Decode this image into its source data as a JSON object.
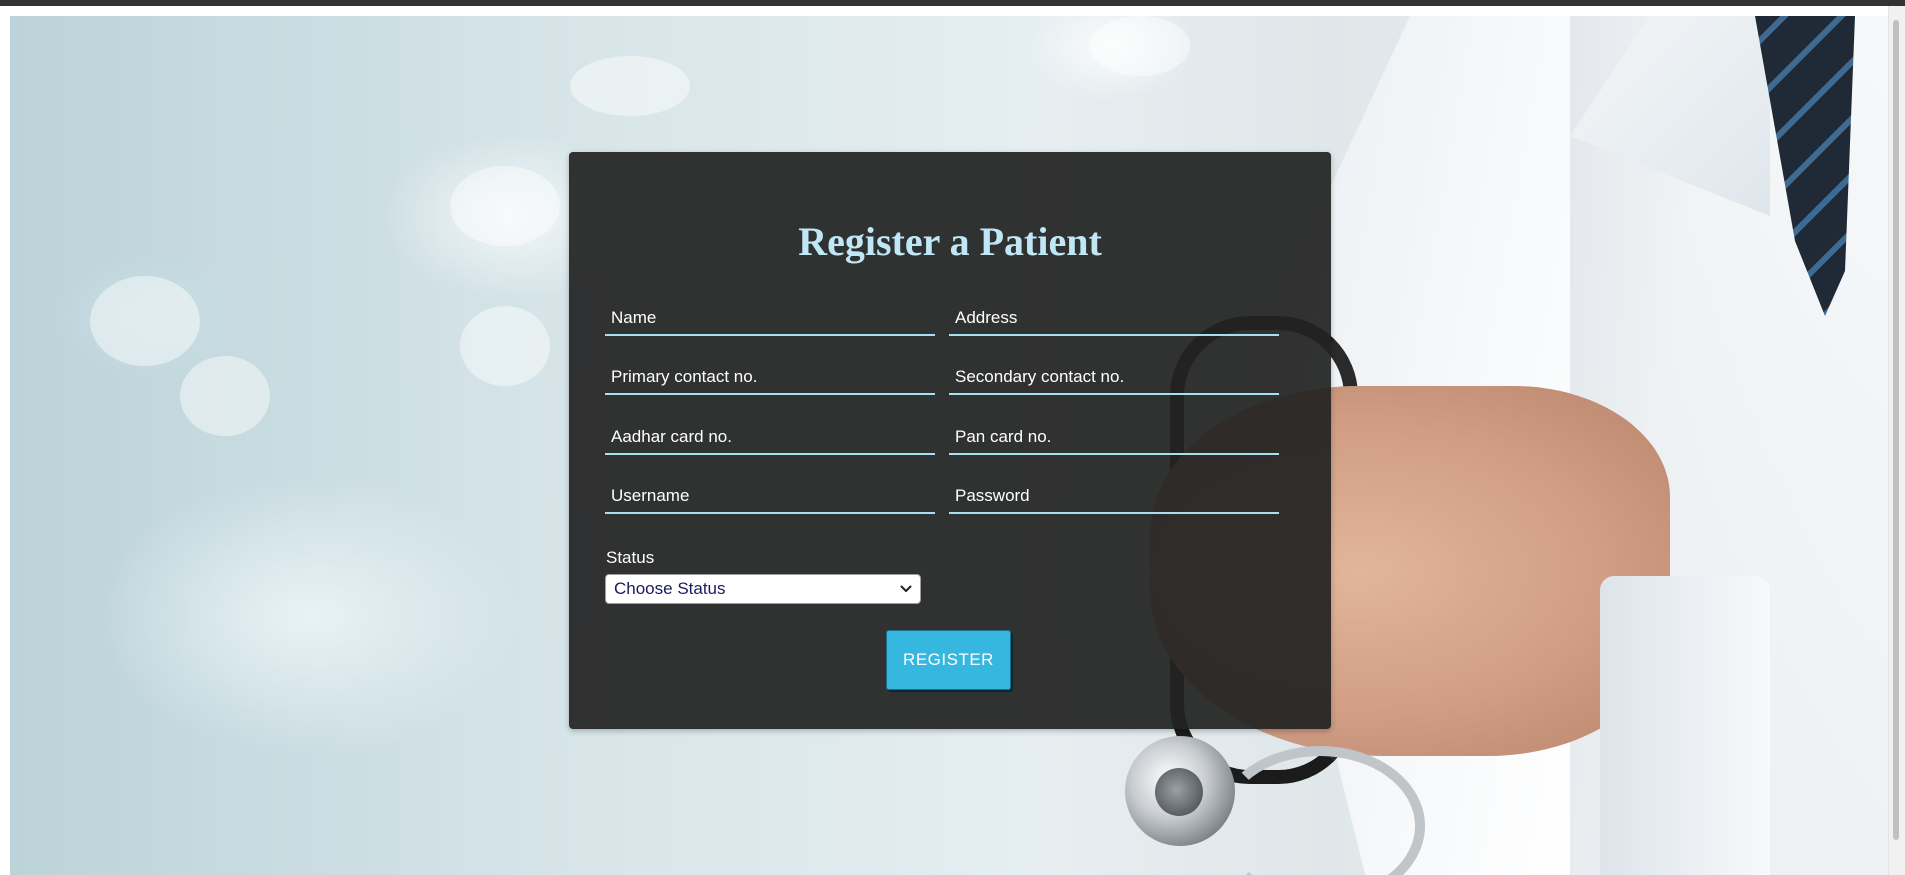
{
  "page": {
    "title": "Register a Patient"
  },
  "form": {
    "fields": {
      "name": {
        "placeholder": "Name",
        "value": ""
      },
      "address": {
        "placeholder": "Address",
        "value": ""
      },
      "primary_contact": {
        "placeholder": "Primary contact no.",
        "value": ""
      },
      "secondary_contact": {
        "placeholder": "Secondary contact no.",
        "value": ""
      },
      "aadhar": {
        "placeholder": "Aadhar card no.",
        "value": ""
      },
      "pan": {
        "placeholder": "Pan card no.",
        "value": ""
      },
      "username": {
        "placeholder": "Username",
        "value": ""
      },
      "password": {
        "placeholder": "Password",
        "value": ""
      }
    },
    "status": {
      "label": "Status",
      "selected": "Choose Status"
    },
    "register_label": "REGISTER"
  },
  "colors": {
    "card_background": "#222222",
    "title": "#bfe7f5",
    "field_underline": "#a7dff0",
    "button": "#35b7df",
    "top_strip": "#333333"
  },
  "icons": {
    "select_arrow": "chevron-down-icon"
  }
}
